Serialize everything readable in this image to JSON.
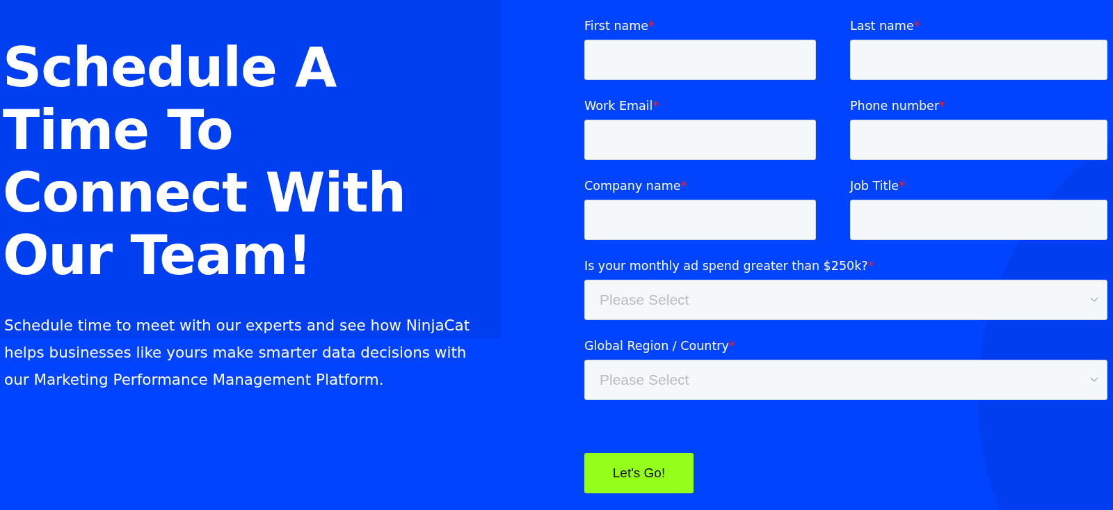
{
  "hero": {
    "heading": "Schedule A Time To Connect With Our Team!",
    "description": "Schedule time to meet with our experts and see how NinjaCat helps businesses like yours make smarter data decisions with our Marketing Performance Management Platform."
  },
  "form": {
    "fields": [
      {
        "kind": "text",
        "label": "First name",
        "required_mark": "*"
      },
      {
        "kind": "text",
        "label": "Last name",
        "required_mark": "*"
      },
      {
        "kind": "text",
        "label": "Work Email",
        "required_mark": "*"
      },
      {
        "kind": "text",
        "label": "Phone number",
        "required_mark": "*"
      },
      {
        "kind": "text",
        "label": "Company name",
        "required_mark": "*"
      },
      {
        "kind": "text",
        "label": "Job Title",
        "required_mark": "*"
      },
      {
        "kind": "select",
        "label": "Is your monthly ad spend greater than $250k?",
        "required_mark": "*",
        "placeholder": "Please Select"
      },
      {
        "kind": "select",
        "label": "Global Region / Country",
        "required_mark": "*",
        "placeholder": "Please Select"
      }
    ],
    "submit": "Let's Go!"
  }
}
